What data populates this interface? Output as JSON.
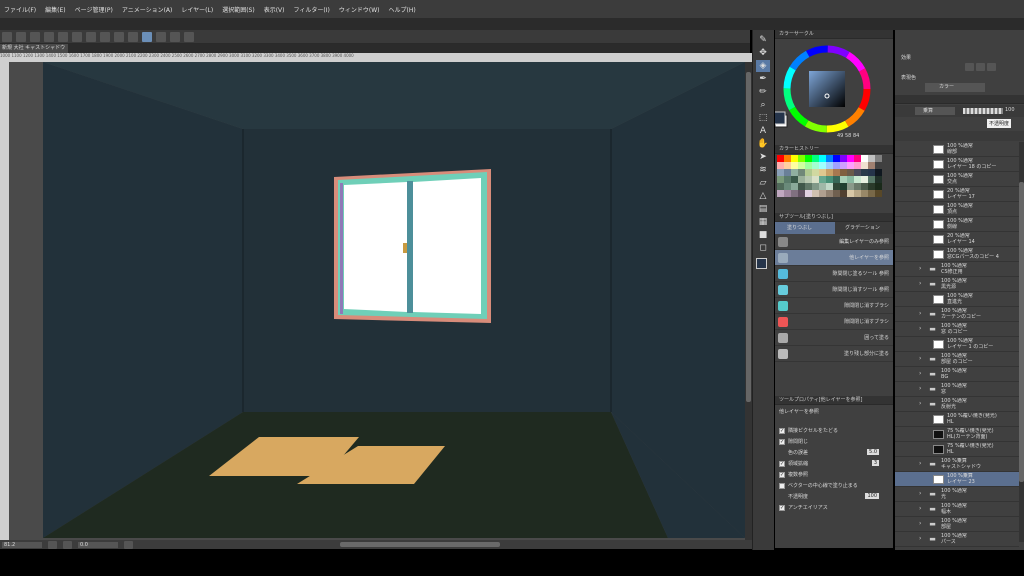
{
  "menu": [
    "ファイル(F)",
    "編集(E)",
    "ページ管理(P)",
    "アニメーション(A)",
    "レイヤー(L)",
    "選択範囲(S)",
    "表示(V)",
    "フィルター(I)",
    "ウィンドウ(W)",
    "ヘルプ(H)"
  ],
  "document_tab": "新規 大社 キャストシャドウ",
  "ruler_numbers": "1000 1100 1200 1300 1400 1500 1600 1700 1800 1900 2000 2100 2200 2300 2400 2500 2600 2700 2800 2900 3000 3100 3200 3300 3400 3500 3600 3700 3800 3900 4000",
  "status": {
    "zoom": "81.2",
    "angle": "0.0"
  },
  "tool_icons": [
    "dropper-icon",
    "move-icon",
    "fill-icon",
    "pen-icon",
    "brush-icon",
    "zoom-icon",
    "selection-icon",
    "text-icon",
    "hand-icon",
    "operation-icon",
    "blend-icon",
    "eraser-icon",
    "figure-icon",
    "ruler-icon",
    "frame-icon",
    "color-icon",
    "transparent-icon"
  ],
  "color_circle": {
    "title": "カラーサークル",
    "values": [
      "49",
      "58",
      "84"
    ],
    "main_color": "#25344a",
    "sub_color": "#ffffff"
  },
  "color_history": {
    "title": "カラーヒストリー"
  },
  "subtool": {
    "title": "サブツール[塗りつぶし]",
    "tabs": [
      "塗りつぶし",
      "グラデーション"
    ],
    "items": [
      "編集レイヤーのみ参照",
      "他レイヤーを参照",
      "隙間閉じ塗るツール 参照",
      "隙間閉じ消すツール 参照",
      "隙間閉じ消すブラシ",
      "隙間閉じ消すブラシ",
      "囲って塗る",
      "塗り残し部分に塗る"
    ]
  },
  "tool_property": {
    "title": "ツールプロパティ[他レイヤーを参照]",
    "name": "他レイヤーを参照",
    "rows": [
      {
        "label": "隣接ピクセルをたどる",
        "checked": true
      },
      {
        "label": "隙間閉じ",
        "checked": true
      },
      {
        "label": "色の誤差",
        "value": "5.0"
      },
      {
        "label": "領域拡縮",
        "checked": true,
        "value": "3"
      },
      {
        "label": "複数参照",
        "checked": true
      },
      {
        "label": "ベクターの中心線で塗り止まる",
        "checked": false
      },
      {
        "label": "不透明度",
        "value": "100"
      },
      {
        "label": "アンチエイリアス",
        "checked": true
      }
    ]
  },
  "effect_panel": {
    "title": "効果",
    "expression_label": "表現色",
    "expression_value": "カラー"
  },
  "layer_panel": {
    "blend_mode": "乗算",
    "opacity": "100",
    "tooltip": "不透明度",
    "layers": [
      {
        "mode": "100 %通常",
        "name": "線部",
        "type": "layer"
      },
      {
        "mode": "100 %通常",
        "name": "レイヤー 18 のコピー",
        "type": "layer"
      },
      {
        "mode": "100 %通常",
        "name": "交点",
        "type": "layer"
      },
      {
        "mode": "20 %通常",
        "name": "レイヤー 17",
        "type": "layer"
      },
      {
        "mode": "100 %通常",
        "name": "頂点",
        "type": "layer"
      },
      {
        "mode": "100 %通常",
        "name": "側線",
        "type": "layer"
      },
      {
        "mode": "20 %通常",
        "name": "レイヤー 14",
        "type": "layer"
      },
      {
        "mode": "100 %通常",
        "name": "窓CGパースのコピー 4",
        "type": "layer"
      },
      {
        "mode": "100 %通常",
        "name": "CS修正用",
        "type": "folder"
      },
      {
        "mode": "100 %通常",
        "name": "黒光源",
        "type": "folder"
      },
      {
        "mode": "100 %通常",
        "name": "直進光",
        "type": "layer"
      },
      {
        "mode": "100 %通常",
        "name": "カーテンのコピー",
        "type": "folder"
      },
      {
        "mode": "100 %通常",
        "name": "窓 のコピー",
        "type": "folder"
      },
      {
        "mode": "100 %通常",
        "name": "レイヤー 1 のコピー",
        "type": "layer"
      },
      {
        "mode": "100 %通常",
        "name": "部屋 のコピー",
        "type": "folder"
      },
      {
        "mode": "100 %通常",
        "name": "BG",
        "type": "folder"
      },
      {
        "mode": "100 %通常",
        "name": "窓",
        "type": "folder"
      },
      {
        "mode": "100 %通常",
        "name": "反射光",
        "type": "folder"
      },
      {
        "mode": "100 %覆い焼き(発光)",
        "name": "HL",
        "type": "layer"
      },
      {
        "mode": "75 %覆い焼き(発光)",
        "name": "HL(カーテン背面)",
        "type": "dark"
      },
      {
        "mode": "75 %覆い焼き(発光)",
        "name": "HL",
        "type": "dark"
      },
      {
        "mode": "100 %乗算",
        "name": "キャストシャドウ",
        "type": "folder"
      },
      {
        "mode": "100 %乗算",
        "name": "レイヤー 23",
        "type": "selected"
      },
      {
        "mode": "100 %通常",
        "name": "光",
        "type": "folder"
      },
      {
        "mode": "100 %通常",
        "name": "幅木",
        "type": "folder"
      },
      {
        "mode": "100 %通常",
        "name": "部屋",
        "type": "folder"
      },
      {
        "mode": "100 %通常",
        "name": "パース",
        "type": "folder"
      }
    ]
  },
  "colors": {
    "wall": "#25343c",
    "floor": "#1f2a1f",
    "sunlight": "#d8a860",
    "window_frame": "#6fcfb8",
    "window_edge": "#d88c7a",
    "accent": "#6b8fb8"
  }
}
